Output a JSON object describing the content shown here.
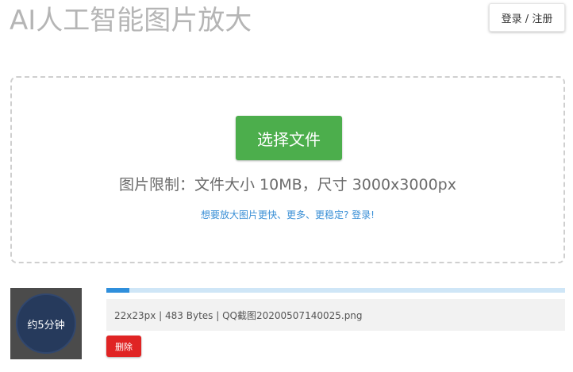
{
  "header": {
    "title": "AI人工智能图片放大",
    "login_label": "登录 / 注册"
  },
  "upload": {
    "choose_file_label": "选择文件",
    "limit_text": "图片限制：文件大小 10MB，尺寸 3000x3000px",
    "login_prompt": "想要放大图片更快、更多、更稳定? 登录!"
  },
  "file_item": {
    "eta_label": "约5分钟",
    "progress_fraction": 0.05,
    "info": "22x23px | 483 Bytes | QQ截图20200507140025.png",
    "delete_label": "删除"
  },
  "colors": {
    "title": "#b5b5b5",
    "choose_button": "#4cae4c",
    "link": "#3a8fd6",
    "progress_fill": "#2f8fdc",
    "progress_track": "#cfe6f7",
    "delete_button": "#e02424"
  }
}
